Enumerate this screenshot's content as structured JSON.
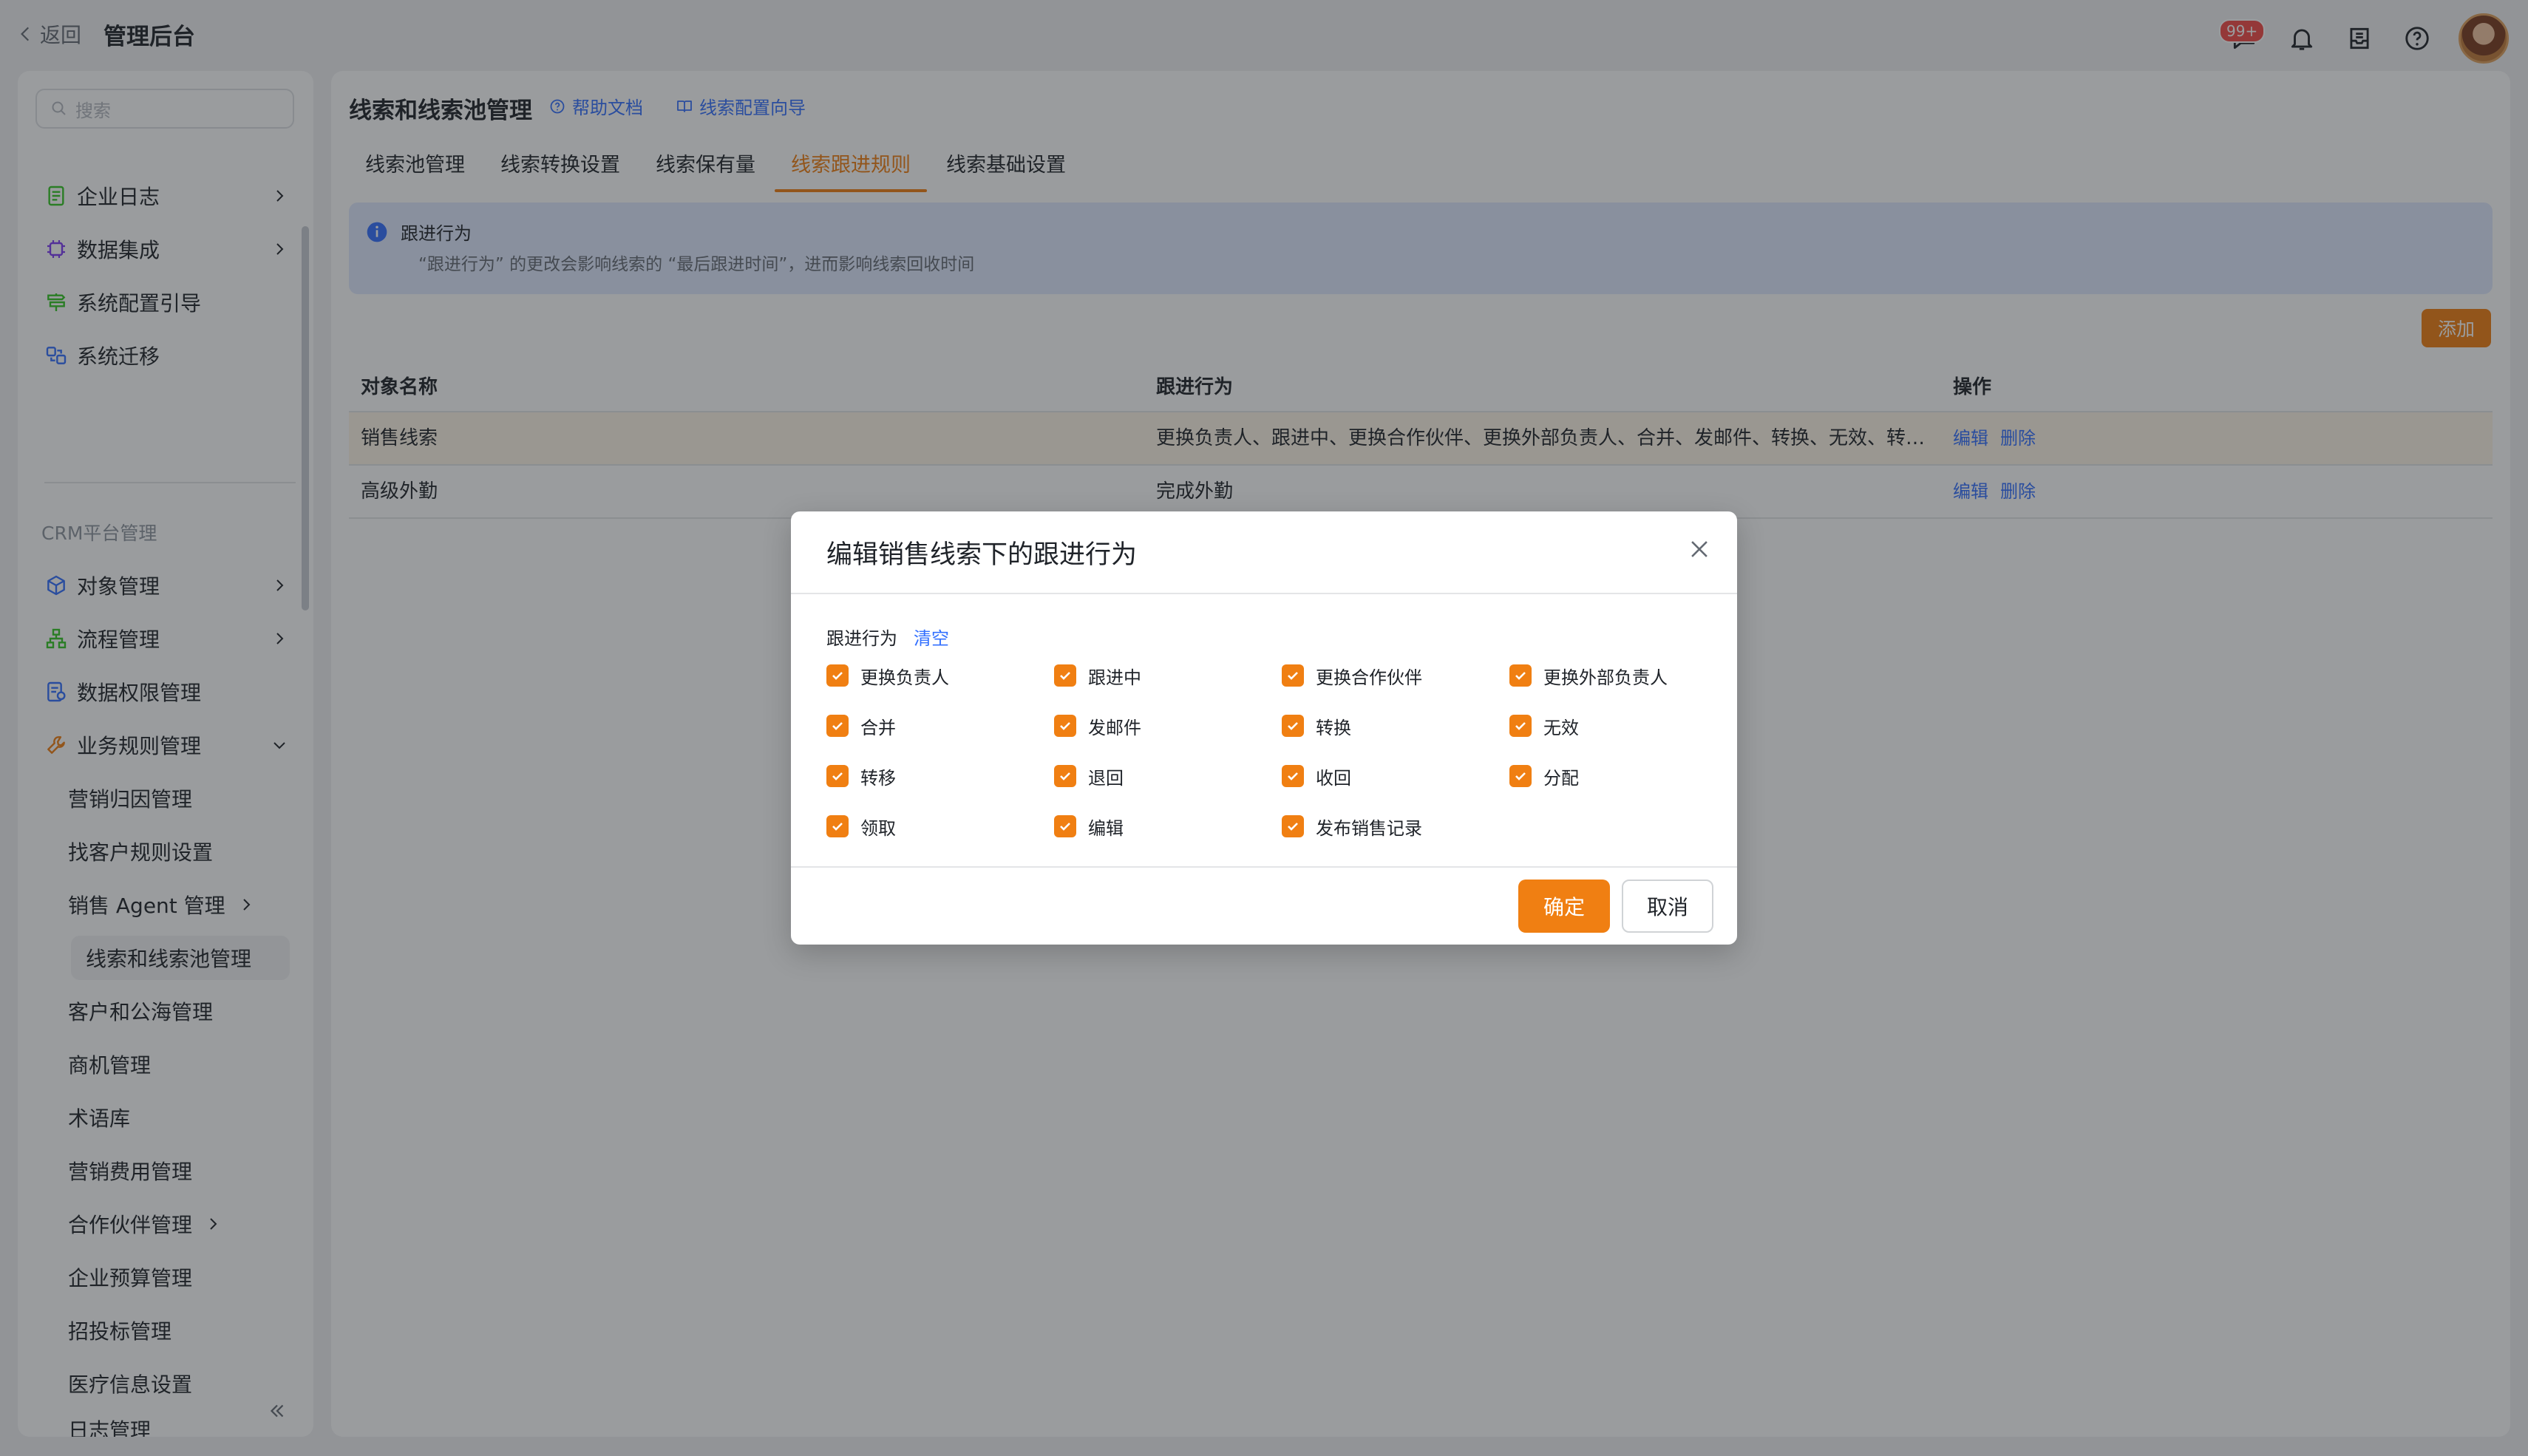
{
  "topbar": {
    "back_label": "返回",
    "app_title": "管理后台",
    "notification_badge": "99+"
  },
  "sidebar": {
    "search_placeholder": "搜索",
    "items": [
      {
        "label": "企业日志",
        "icon": "log-icon",
        "has_chevron": true
      },
      {
        "label": "数据集成",
        "icon": "chip-icon",
        "has_chevron": true
      },
      {
        "label": "系统配置引导",
        "icon": "signpost-icon",
        "has_chevron": false
      },
      {
        "label": "系统迁移",
        "icon": "migrate-icon",
        "has_chevron": false
      }
    ],
    "section_label": "CRM平台管理",
    "crm_items": [
      {
        "label": "对象管理",
        "icon": "cube-icon",
        "has_chevron": true
      },
      {
        "label": "流程管理",
        "icon": "flow-icon",
        "has_chevron": true
      },
      {
        "label": "数据权限管理",
        "icon": "permission-icon",
        "has_chevron": false
      },
      {
        "label": "业务规则管理",
        "icon": "wrench-icon",
        "expanded": true
      }
    ],
    "sub_items": [
      {
        "label": "营销归因管理"
      },
      {
        "label": "找客户规则设置"
      },
      {
        "label": "销售 Agent 管理",
        "has_chevron": true
      },
      {
        "label": "线索和线索池管理",
        "active": true
      },
      {
        "label": "客户和公海管理"
      },
      {
        "label": "商机管理"
      },
      {
        "label": "术语库"
      },
      {
        "label": "营销费用管理"
      },
      {
        "label": "合作伙伴管理",
        "has_chevron": true
      },
      {
        "label": "企业预算管理"
      },
      {
        "label": "招投标管理"
      },
      {
        "label": "医疗信息设置"
      },
      {
        "label": "日志管理"
      }
    ]
  },
  "main": {
    "title": "线索和线索池管理",
    "help_link": "帮助文档",
    "guide_link": "线索配置向导",
    "tabs": [
      {
        "label": "线索池管理"
      },
      {
        "label": "线索转换设置"
      },
      {
        "label": "线索保有量"
      },
      {
        "label": "线索跟进规则",
        "active": true
      },
      {
        "label": "线索基础设置"
      }
    ],
    "alert": {
      "title": "跟进行为",
      "description": "“跟进行为” 的更改会影响线索的 “最后跟进时间”，进而影响线索回收时间"
    },
    "add_button": "添加",
    "table": {
      "headers": [
        "对象名称",
        "跟进行为",
        "操作"
      ],
      "rows": [
        {
          "name": "销售线索",
          "behaviors": "更换负责人、跟进中、更换合作伙伴、更换外部负责人、合并、发邮件、转换、无效、转…",
          "edit": "编辑",
          "delete": "删除"
        },
        {
          "name": "高级外勤",
          "behaviors": "完成外勤",
          "edit": "编辑",
          "delete": "删除"
        }
      ]
    }
  },
  "modal": {
    "title": "编辑销售线索下的跟进行为",
    "field_label": "跟进行为",
    "clear_label": "清空",
    "options": [
      {
        "label": "更换负责人",
        "checked": true
      },
      {
        "label": "跟进中",
        "checked": true
      },
      {
        "label": "更换合作伙伴",
        "checked": true
      },
      {
        "label": "更换外部负责人",
        "checked": true
      },
      {
        "label": "合并",
        "checked": true
      },
      {
        "label": "发邮件",
        "checked": true
      },
      {
        "label": "转换",
        "checked": true
      },
      {
        "label": "无效",
        "checked": true
      },
      {
        "label": "转移",
        "checked": true
      },
      {
        "label": "退回",
        "checked": true
      },
      {
        "label": "收回",
        "checked": true
      },
      {
        "label": "分配",
        "checked": true
      },
      {
        "label": "领取",
        "checked": true
      },
      {
        "label": "编辑",
        "checked": true
      },
      {
        "label": "发布销售记录",
        "checked": true
      }
    ],
    "ok_label": "确定",
    "cancel_label": "取消"
  },
  "colors": {
    "accent": "#f07f12",
    "link": "#3370ff",
    "alert_bg": "#e1eaff",
    "badge": "#f54a45"
  }
}
